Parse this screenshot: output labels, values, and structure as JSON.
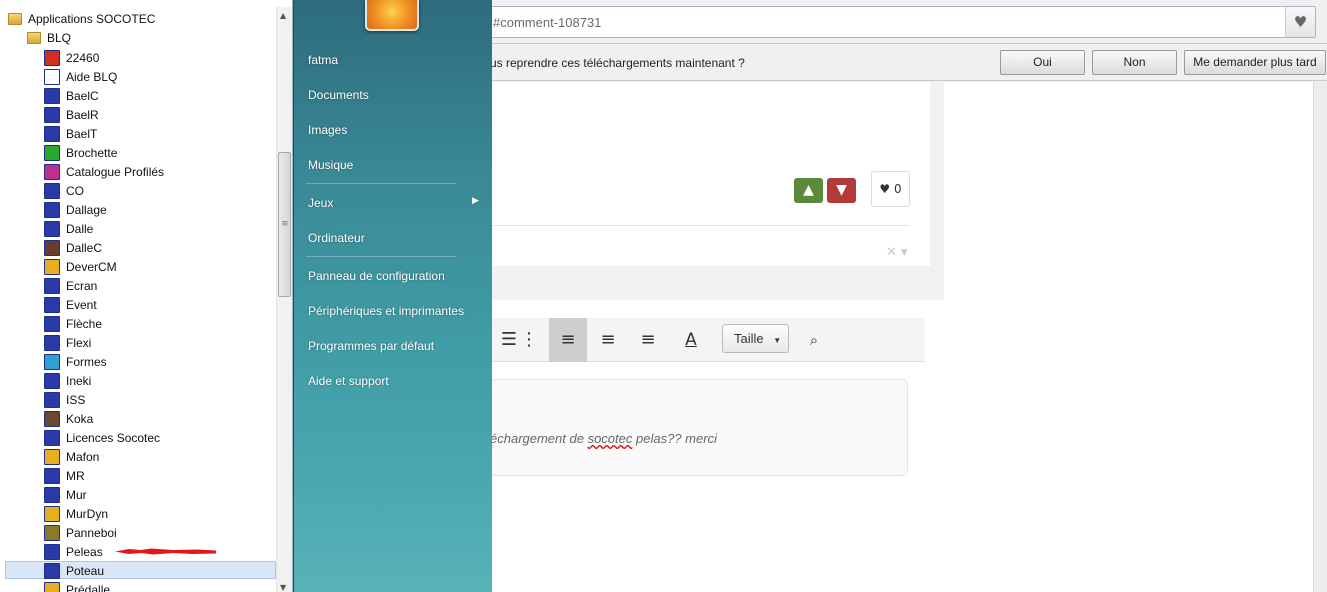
{
  "browser": {
    "url": "#comment-108731",
    "favorite_icon": "heart-icon"
  },
  "download_bar": {
    "message": "us reprendre ces téléchargements maintenant ?",
    "buttons": [
      "Oui",
      "Non",
      "Me demander plus tard"
    ]
  },
  "comment": {
    "like_count": "0",
    "upvote_icon": "arrow-up-icon",
    "downvote_icon": "arrow-down-icon"
  },
  "editor": {
    "size_select": "Taille",
    "text_prefix": "échargement de ",
    "text_misspelled": "socotec",
    "text_suffix": " pelas?? merci"
  },
  "start_menu": {
    "right_items": [
      {
        "label": "fatma"
      },
      {
        "label": "Documents"
      },
      {
        "label": "Images"
      },
      {
        "label": "Musique"
      },
      {
        "label": "Jeux"
      },
      {
        "label": "Ordinateur"
      },
      {
        "label": "Panneau de configuration"
      },
      {
        "label": "Périphériques et imprimantes"
      },
      {
        "label": "Programmes par défaut"
      },
      {
        "label": "Aide et support"
      }
    ],
    "folder_root": "Applications SOCOTEC",
    "folder_sub": "BLQ",
    "programs": [
      {
        "label": "22460",
        "color": "#d03020"
      },
      {
        "label": "Aide BLQ",
        "color": "#ffffff"
      },
      {
        "label": "BaelC",
        "color": "#2a3aa8"
      },
      {
        "label": "BaelR",
        "color": "#2a3aa8"
      },
      {
        "label": "BaelT",
        "color": "#2a3aa8"
      },
      {
        "label": "Brochette",
        "color": "#2aa82a"
      },
      {
        "label": "Catalogue Profilés",
        "color": "#c03090"
      },
      {
        "label": "CO",
        "color": "#2a3aa8"
      },
      {
        "label": "Dallage",
        "color": "#2a3aa8"
      },
      {
        "label": "Dalle",
        "color": "#2a3aa8"
      },
      {
        "label": "DalleC",
        "color": "#6a3a2a"
      },
      {
        "label": "DeverCM",
        "color": "#e8b020"
      },
      {
        "label": "Ecran",
        "color": "#2a3aa8"
      },
      {
        "label": "Event",
        "color": "#2a3aa8"
      },
      {
        "label": "Flèche",
        "color": "#2a3aa8"
      },
      {
        "label": "Flexi",
        "color": "#2a3aa8"
      },
      {
        "label": "Formes",
        "color": "#30a0d0"
      },
      {
        "label": "Ineki",
        "color": "#2a3aa8"
      },
      {
        "label": "ISS",
        "color": "#2a3aa8"
      },
      {
        "label": "Koka",
        "color": "#6a4a2a"
      },
      {
        "label": "Licences Socotec",
        "color": "#2a3aa8"
      },
      {
        "label": "Mafon",
        "color": "#e8b020"
      },
      {
        "label": "MR",
        "color": "#2a3aa8"
      },
      {
        "label": "Mur",
        "color": "#2a3aa8"
      },
      {
        "label": "MurDyn",
        "color": "#e8b020"
      },
      {
        "label": "Panneboi",
        "color": "#8a7a2a"
      },
      {
        "label": "Peleas",
        "color": "#2a3aa8"
      },
      {
        "label": "Poteau",
        "color": "#2a3aa8"
      },
      {
        "label": "Prédalle",
        "color": "#e8b020"
      }
    ],
    "selected_program": "Poteau"
  },
  "annotation_color": "#e0191c"
}
